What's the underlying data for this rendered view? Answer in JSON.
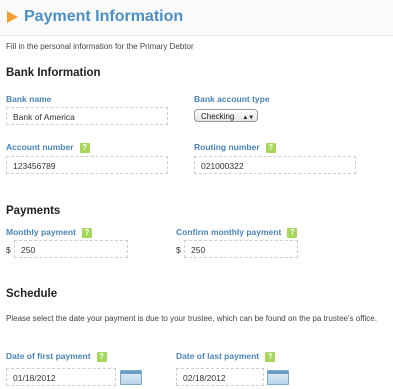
{
  "header": {
    "title": "Payment Information"
  },
  "intro": "Fill in the personal information for the Primary Debtor",
  "bank": {
    "section_title": "Bank Information",
    "bank_name_label": "Bank name",
    "bank_name_value": "Bank of America",
    "account_type_label": "Bank account type",
    "account_type_value": "Checking",
    "account_number_label": "Account number",
    "account_number_value": "123456789",
    "routing_number_label": "Routing number",
    "routing_number_value": "021000322"
  },
  "payments": {
    "section_title": "Payments",
    "monthly_label": "Monthly payment",
    "monthly_currency": "$",
    "monthly_value": "250",
    "confirm_label": "Confirm monthly payment",
    "confirm_currency": "$",
    "confirm_value": "250"
  },
  "schedule": {
    "section_title": "Schedule",
    "description": "Please select the date your payment is due to your trustee, which can be found on the pa trustee's office.",
    "first_label": "Date of first payment",
    "first_value": "01/18/2012",
    "last_label": "Date of last payment",
    "last_value": "02/18/2012"
  },
  "help": {
    "glyph": "?"
  },
  "icons": {
    "header": "arrow-right-icon",
    "help": "help-icon",
    "calendar": "calendar-icon"
  },
  "colors": {
    "title": "#4a90c6",
    "label": "#4a84b8",
    "help": "#a6d65a",
    "arrow": "#f0a030"
  }
}
